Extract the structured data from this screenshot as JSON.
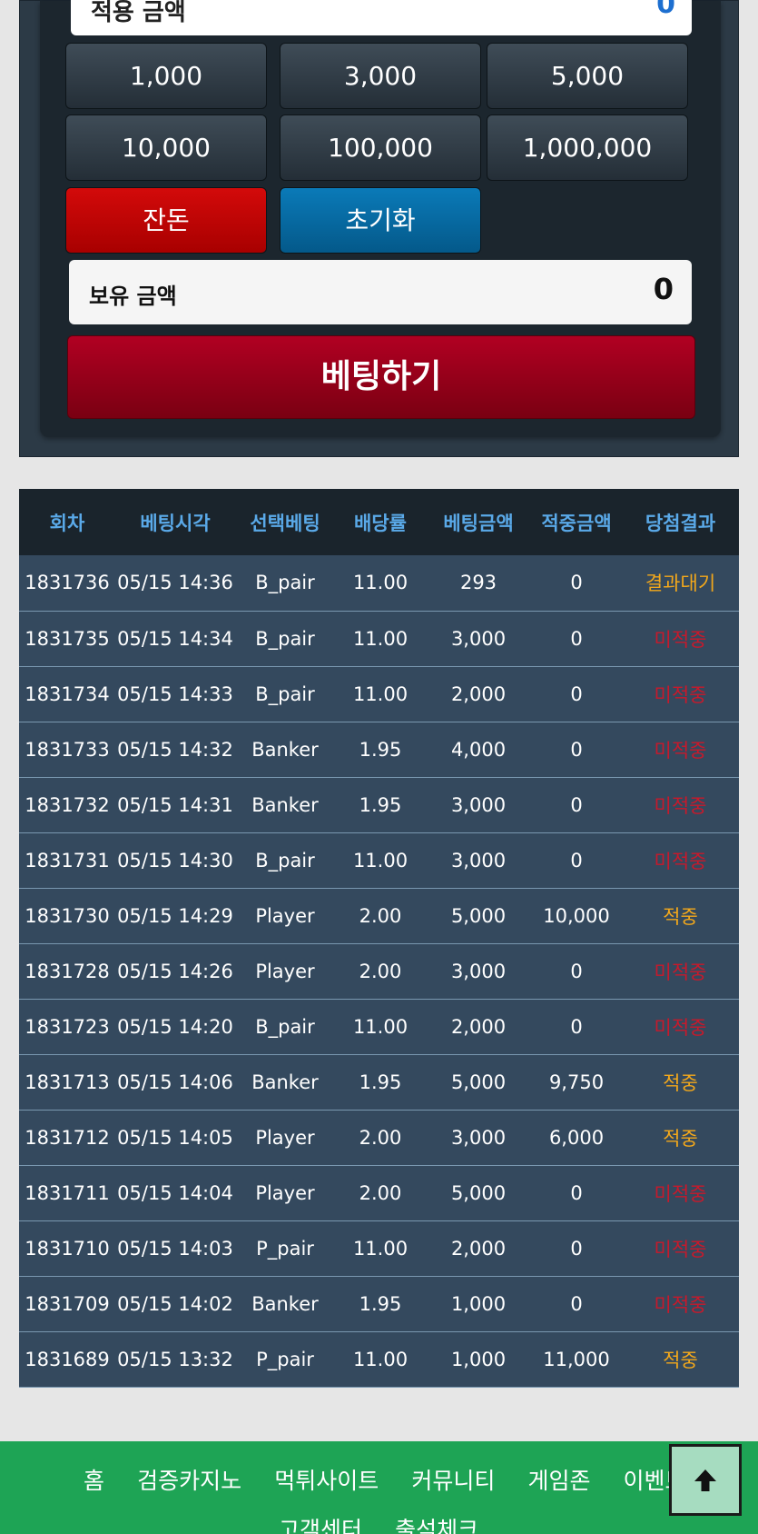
{
  "bet_panel": {
    "top_field_label": "적용 금액",
    "top_field_value": "0",
    "chips": [
      "1,000",
      "3,000",
      "5,000",
      "10,000",
      "100,000",
      "1,000,000"
    ],
    "balance_label": "잔돈",
    "reset_label": "초기화",
    "hold_label": "보유 금액",
    "hold_value": "0",
    "bet_button_label": "베팅하기"
  },
  "history": {
    "columns": [
      "회차",
      "베팅시각",
      "선택베팅",
      "배당률",
      "베팅금액",
      "적중금액",
      "당첨결과"
    ],
    "rows": [
      [
        "1831736",
        "05/15 14:36",
        "B_pair",
        "11.00",
        "293",
        "0",
        "결과대기"
      ],
      [
        "1831735",
        "05/15 14:34",
        "B_pair",
        "11.00",
        "3,000",
        "0",
        "미적중"
      ],
      [
        "1831734",
        "05/15 14:33",
        "B_pair",
        "11.00",
        "2,000",
        "0",
        "미적중"
      ],
      [
        "1831733",
        "05/15 14:32",
        "Banker",
        "1.95",
        "4,000",
        "0",
        "미적중"
      ],
      [
        "1831732",
        "05/15 14:31",
        "Banker",
        "1.95",
        "3,000",
        "0",
        "미적중"
      ],
      [
        "1831731",
        "05/15 14:30",
        "B_pair",
        "11.00",
        "3,000",
        "0",
        "미적중"
      ],
      [
        "1831730",
        "05/15 14:29",
        "Player",
        "2.00",
        "5,000",
        "10,000",
        "적중"
      ],
      [
        "1831728",
        "05/15 14:26",
        "Player",
        "2.00",
        "3,000",
        "0",
        "미적중"
      ],
      [
        "1831723",
        "05/15 14:20",
        "B_pair",
        "11.00",
        "2,000",
        "0",
        "미적중"
      ],
      [
        "1831713",
        "05/15 14:06",
        "Banker",
        "1.95",
        "5,000",
        "9,750",
        "적중"
      ],
      [
        "1831712",
        "05/15 14:05",
        "Player",
        "2.00",
        "3,000",
        "6,000",
        "적중"
      ],
      [
        "1831711",
        "05/15 14:04",
        "Player",
        "2.00",
        "5,000",
        "0",
        "미적중"
      ],
      [
        "1831710",
        "05/15 14:03",
        "P_pair",
        "11.00",
        "2,000",
        "0",
        "미적중"
      ],
      [
        "1831709",
        "05/15 14:02",
        "Banker",
        "1.95",
        "1,000",
        "0",
        "미적중"
      ],
      [
        "1831689",
        "05/15 13:32",
        "P_pair",
        "11.00",
        "1,000",
        "11,000",
        "적중"
      ]
    ]
  },
  "footer_nav": {
    "items_row1": [
      "홈",
      "검증카지노",
      "먹튀사이트",
      "커뮤니티",
      "게임존",
      "이벤트"
    ],
    "items_row2": [
      "고객센터",
      "출석체크"
    ]
  },
  "colors": {
    "result_wait": "#f3a81b",
    "result_miss": "#c8192b",
    "result_hit": "#f3a81b",
    "footer": "#1ea455"
  },
  "icons": {
    "scroll_top": "arrow-up-icon"
  }
}
